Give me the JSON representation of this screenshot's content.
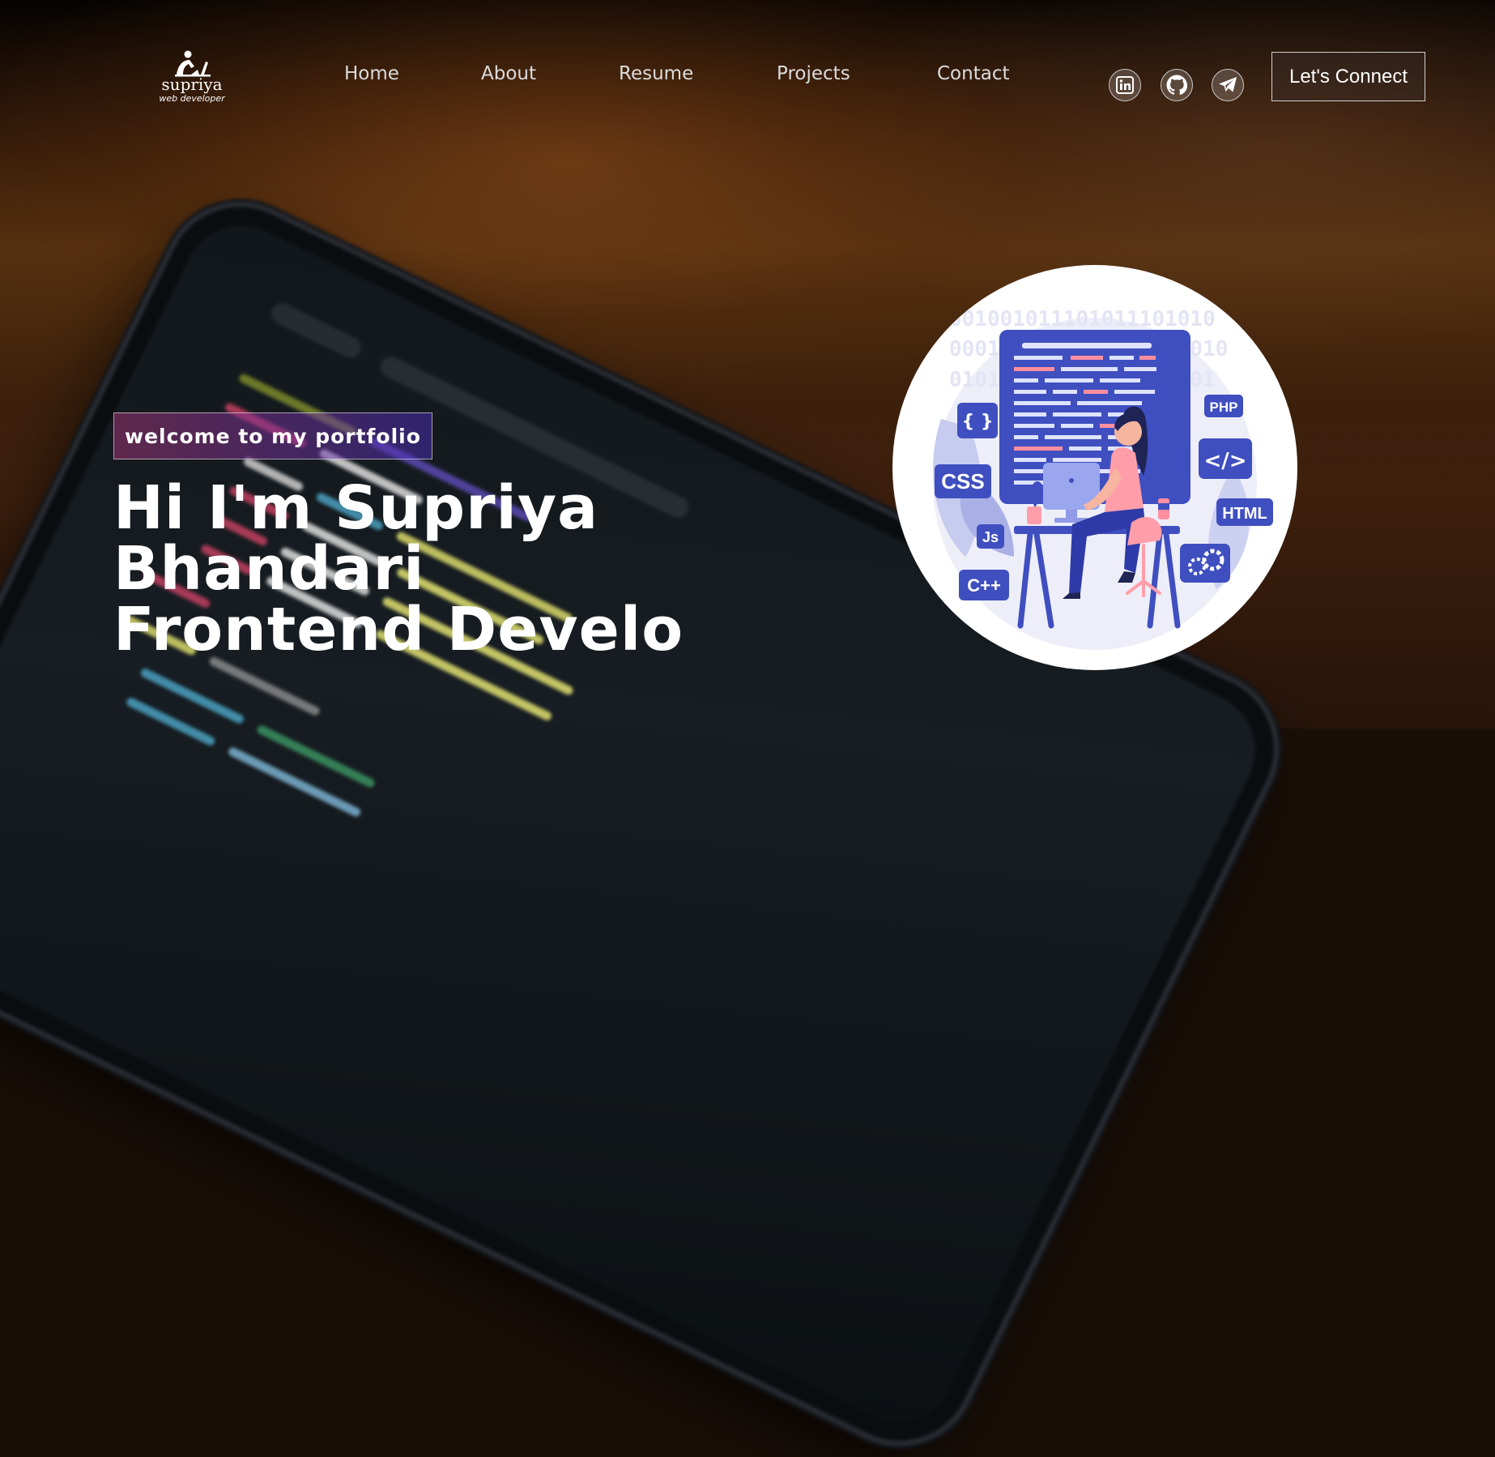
{
  "logo": {
    "name": "supriya",
    "tagline": "web developer",
    "icon": "person-at-laptop-icon"
  },
  "nav": {
    "links": [
      {
        "label": "Home"
      },
      {
        "label": "About"
      },
      {
        "label": "Resume"
      },
      {
        "label": "Projects"
      },
      {
        "label": "Contact"
      }
    ]
  },
  "social": [
    {
      "icon": "linkedin-icon"
    },
    {
      "icon": "github-icon"
    },
    {
      "icon": "telegram-icon"
    }
  ],
  "connect_label": "Let's Connect",
  "hero": {
    "tagline": "welcome to my portfolio",
    "line1": "Hi I'm Supriya",
    "line2": "Bhandari",
    "line3": "Frontend Develo"
  },
  "illustration": {
    "binary_1": "001001011101011101010",
    "binary_2": "0001010010110101010010",
    "binary_3": "010101101011010101101",
    "labels": {
      "braces": "{ }",
      "css": "CSS",
      "js": "Js",
      "cpp": "C++",
      "php": "PHP",
      "code": "</>",
      "html": "HTML"
    }
  },
  "colors": {
    "accent_pink": "#aa367c",
    "accent_purple": "#4a2fbd",
    "illus_blue": "#3f4fc0"
  }
}
